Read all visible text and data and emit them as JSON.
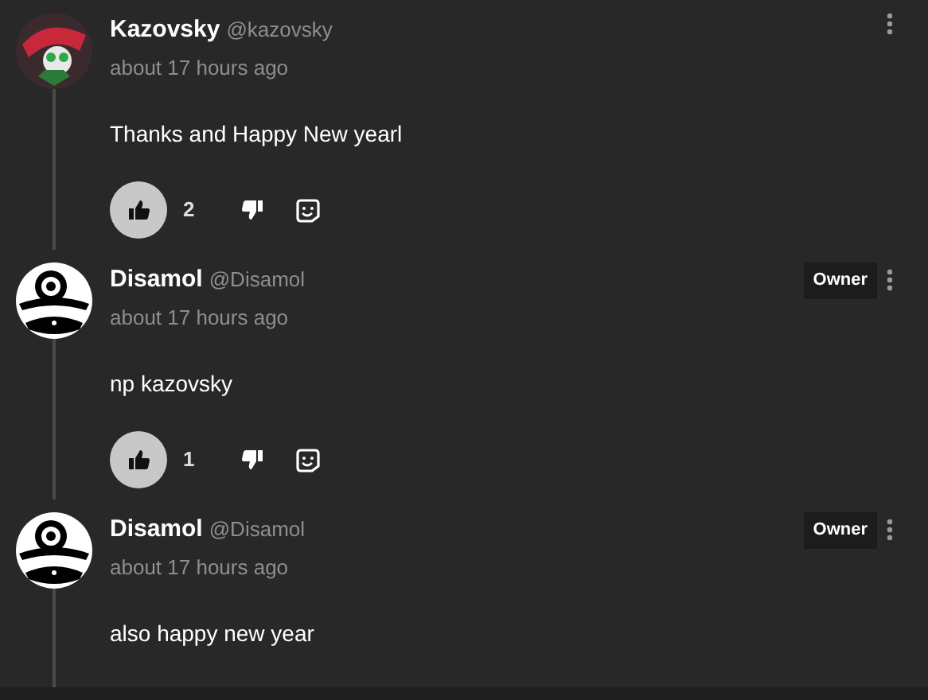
{
  "comments": [
    {
      "kind": "jester",
      "author": "Kazovsky",
      "handle": "@kazovsky",
      "time": "about 17 hours ago",
      "text": "Thanks and Happy New yearl",
      "liked": true,
      "likes": "2"
    },
    {
      "kind": "eye",
      "author": "Disamol",
      "handle": "@Disamol",
      "time": "about 17 hours ago",
      "text": "np kazovsky",
      "badge": "Owner",
      "liked": true,
      "likes": "1"
    },
    {
      "kind": "eye",
      "author": "Disamol",
      "handle": "@Disamol",
      "time": "about 17 hours ago",
      "text": "also happy new year",
      "badge": "Owner"
    }
  ]
}
